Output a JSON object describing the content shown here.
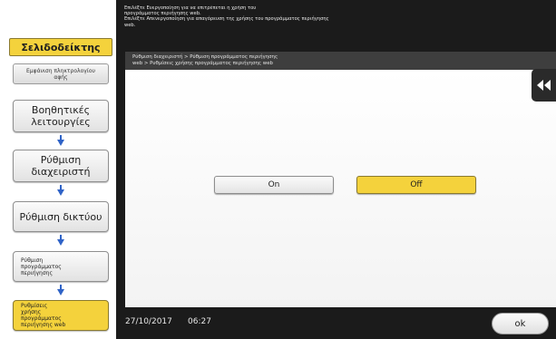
{
  "instructions": {
    "line1": "Επιλέξτε Ενεργοποίηση για να επιτρέπεται η χρήση του",
    "line2": "προγράμματος περιήγησης web.",
    "line3": "Επιλέξτε Απενεργοποίηση για απαγόρευση της χρήσης του προγράμματος περιήγησης",
    "line4": "web."
  },
  "sidebar": {
    "bookmark_tab": "Σελιδοδείκτης",
    "quick_button": "Εμφάνιση πληκτρολογίου αφής",
    "steps": [
      {
        "label": "Βοηθητικές λειτουργίες"
      },
      {
        "label": "Ρύθμιση διαχειριστή"
      },
      {
        "label": "Ρύθμιση δικτύου"
      },
      {
        "label": "Ρύθμιση προγράμματος περιήγησης"
      },
      {
        "label": "Ρυθμίσεις χρήσης προγράμματος περιήγησης web"
      }
    ]
  },
  "panel": {
    "breadcrumb_line1": "Ρύθμιση διαχειριστή > Ρύθμιση προγράμματος περιήγησης",
    "breadcrumb_line2": "web > Ρυθμίσεις χρήσης προγράμματος περιήγησης web",
    "on_label": "On",
    "off_label": "Off",
    "selected": "Off"
  },
  "footer": {
    "date": "27/10/2017",
    "time": "06:27",
    "ok_label": "ok"
  },
  "colors": {
    "selected_yellow": "#f4d23c",
    "step_arrow_blue": "#2f63c7",
    "dark_background": "#1b1b1b"
  },
  "icons": {
    "collapse": "double-chevron-left-icon",
    "step_arrow": "arrow-down-icon"
  }
}
